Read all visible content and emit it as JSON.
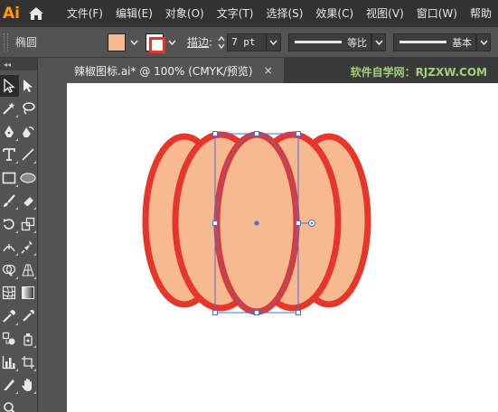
{
  "app": {
    "logo": "Ai"
  },
  "menu": [
    "文件(F)",
    "编辑(E)",
    "对象(O)",
    "文字(T)",
    "选择(S)",
    "效果(C)",
    "视图(V)",
    "窗口(W)",
    "帮助"
  ],
  "control": {
    "object_type": "椭圆",
    "fill_color": "#f6b990",
    "stroke_color": "#e8352a",
    "stroke_label": "描边",
    "stroke_colon": ":",
    "stroke_weight": "7 pt",
    "profile_label": "等比",
    "brush_label": "基本"
  },
  "toolbox": {
    "collapse": "◂◂"
  },
  "document": {
    "tab_title": "辣椒图标.ai* @ 100% (CMYK/预览)",
    "close": "×",
    "watermark": "软件自学网：RJZXW.COM"
  },
  "artwork": {
    "fill": "#f6b990",
    "stroke": "#e8352a",
    "selection_color": "#4a6fe0"
  }
}
